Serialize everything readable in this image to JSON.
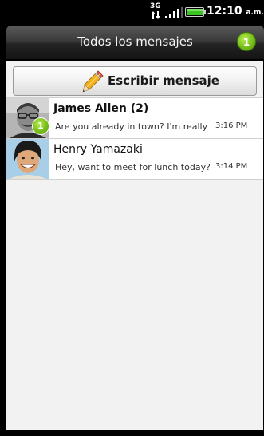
{
  "status_bar": {
    "network": "3G",
    "signal_icon": "signal-icon",
    "battery_icon": "battery-icon",
    "time": "12:10",
    "ampm": "a.m."
  },
  "header": {
    "title": "Todos los mensajes",
    "unread_count": "1"
  },
  "compose": {
    "icon": "pencil-icon",
    "label": "Escribir mensaje"
  },
  "threads": [
    {
      "name": "James Allen (2)",
      "preview": "Are you already in town? I'm really lo",
      "time": "3:16 PM",
      "unread_badge": "1",
      "bold": true
    },
    {
      "name": "Henry Yamazaki",
      "preview": "Hey, want to meet for lunch today?",
      "time": "3:14 PM",
      "bold": false
    }
  ],
  "colors": {
    "badge_green": "#7cc21d",
    "background": "#f2f2f2",
    "title_bar": "#2e2e2e"
  }
}
